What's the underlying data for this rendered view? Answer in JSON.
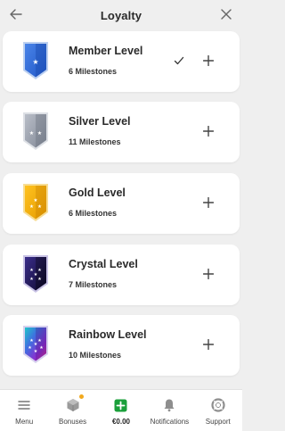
{
  "header": {
    "title": "Loyalty",
    "back_icon": "arrow-left-icon",
    "close_icon": "close-icon"
  },
  "levels": [
    {
      "name": "Member Level",
      "milestones": "6 Milestones",
      "badge": "shield-blue",
      "checked": true
    },
    {
      "name": "Silver Level",
      "milestones": "11 Milestones",
      "badge": "shield-silver",
      "checked": false
    },
    {
      "name": "Gold Level",
      "milestones": "6 Milestones",
      "badge": "shield-gold",
      "checked": false
    },
    {
      "name": "Crystal Level",
      "milestones": "7 Milestones",
      "badge": "shield-crystal",
      "checked": false
    },
    {
      "name": "Rainbow Level",
      "milestones": "10 Milestones",
      "badge": "shield-rainbow",
      "checked": false
    }
  ],
  "nav": [
    {
      "label": "Menu",
      "icon": "hamburger-icon"
    },
    {
      "label": "Bonuses",
      "icon": "gift-box-icon",
      "has_dot": true
    },
    {
      "label": "€0.00",
      "icon": "wallet-plus-icon"
    },
    {
      "label": "Notifications",
      "icon": "bell-icon"
    },
    {
      "label": "Support",
      "icon": "lifebuoy-icon"
    }
  ],
  "colors": {
    "accent_green": "#1a9f3a",
    "dot_orange": "#f2a91d",
    "background": "#efefef"
  }
}
